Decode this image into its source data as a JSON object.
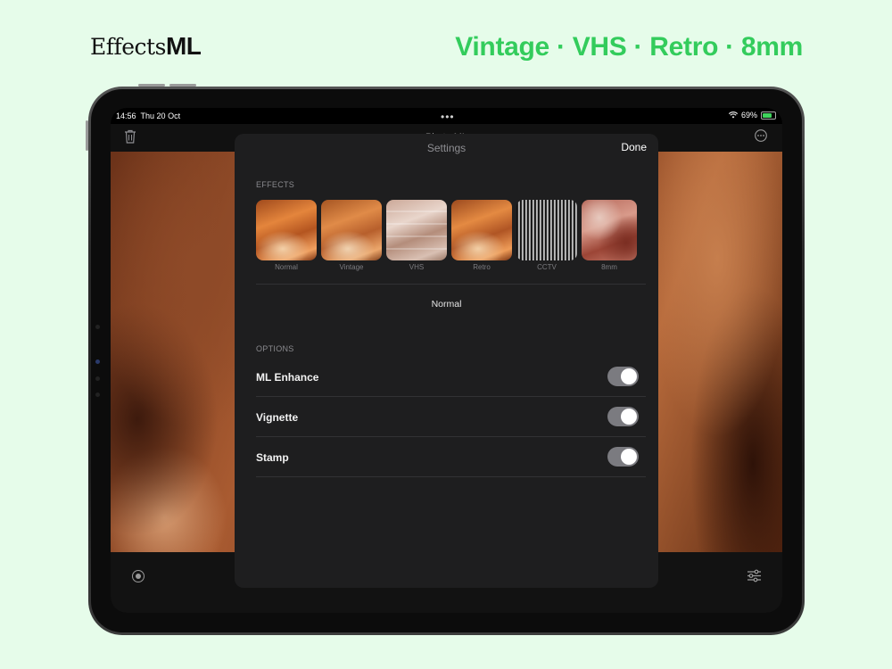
{
  "brand": {
    "name_prefix": "Effects",
    "name_suffix": "ML"
  },
  "tagline": "Vintage · VHS · Retro · 8mm",
  "status_bar": {
    "time": "14:56",
    "date": "Thu 20 Oct",
    "battery": "69%"
  },
  "navbar": {
    "title": "Photo ML"
  },
  "settings": {
    "title": "Settings",
    "done_label": "Done",
    "effects_header": "EFFECTS",
    "effects": [
      {
        "label": "Normal",
        "thumb": "t-normal"
      },
      {
        "label": "Vintage",
        "thumb": "t-vintage"
      },
      {
        "label": "VHS",
        "thumb": "t-vhs"
      },
      {
        "label": "Retro",
        "thumb": "t-retro"
      },
      {
        "label": "CCTV",
        "thumb": "t-cctv"
      },
      {
        "label": "8mm",
        "thumb": "t-8mm"
      }
    ],
    "selected_effect": "Normal",
    "options_header": "OPTIONS",
    "options": [
      {
        "label": "ML Enhance",
        "enabled": true
      },
      {
        "label": "Vignette",
        "enabled": true
      },
      {
        "label": "Stamp",
        "enabled": true
      }
    ]
  },
  "colors": {
    "accent_green": "#33cc5c",
    "background": "#e6fcea",
    "panel": "#1e1e1f"
  }
}
